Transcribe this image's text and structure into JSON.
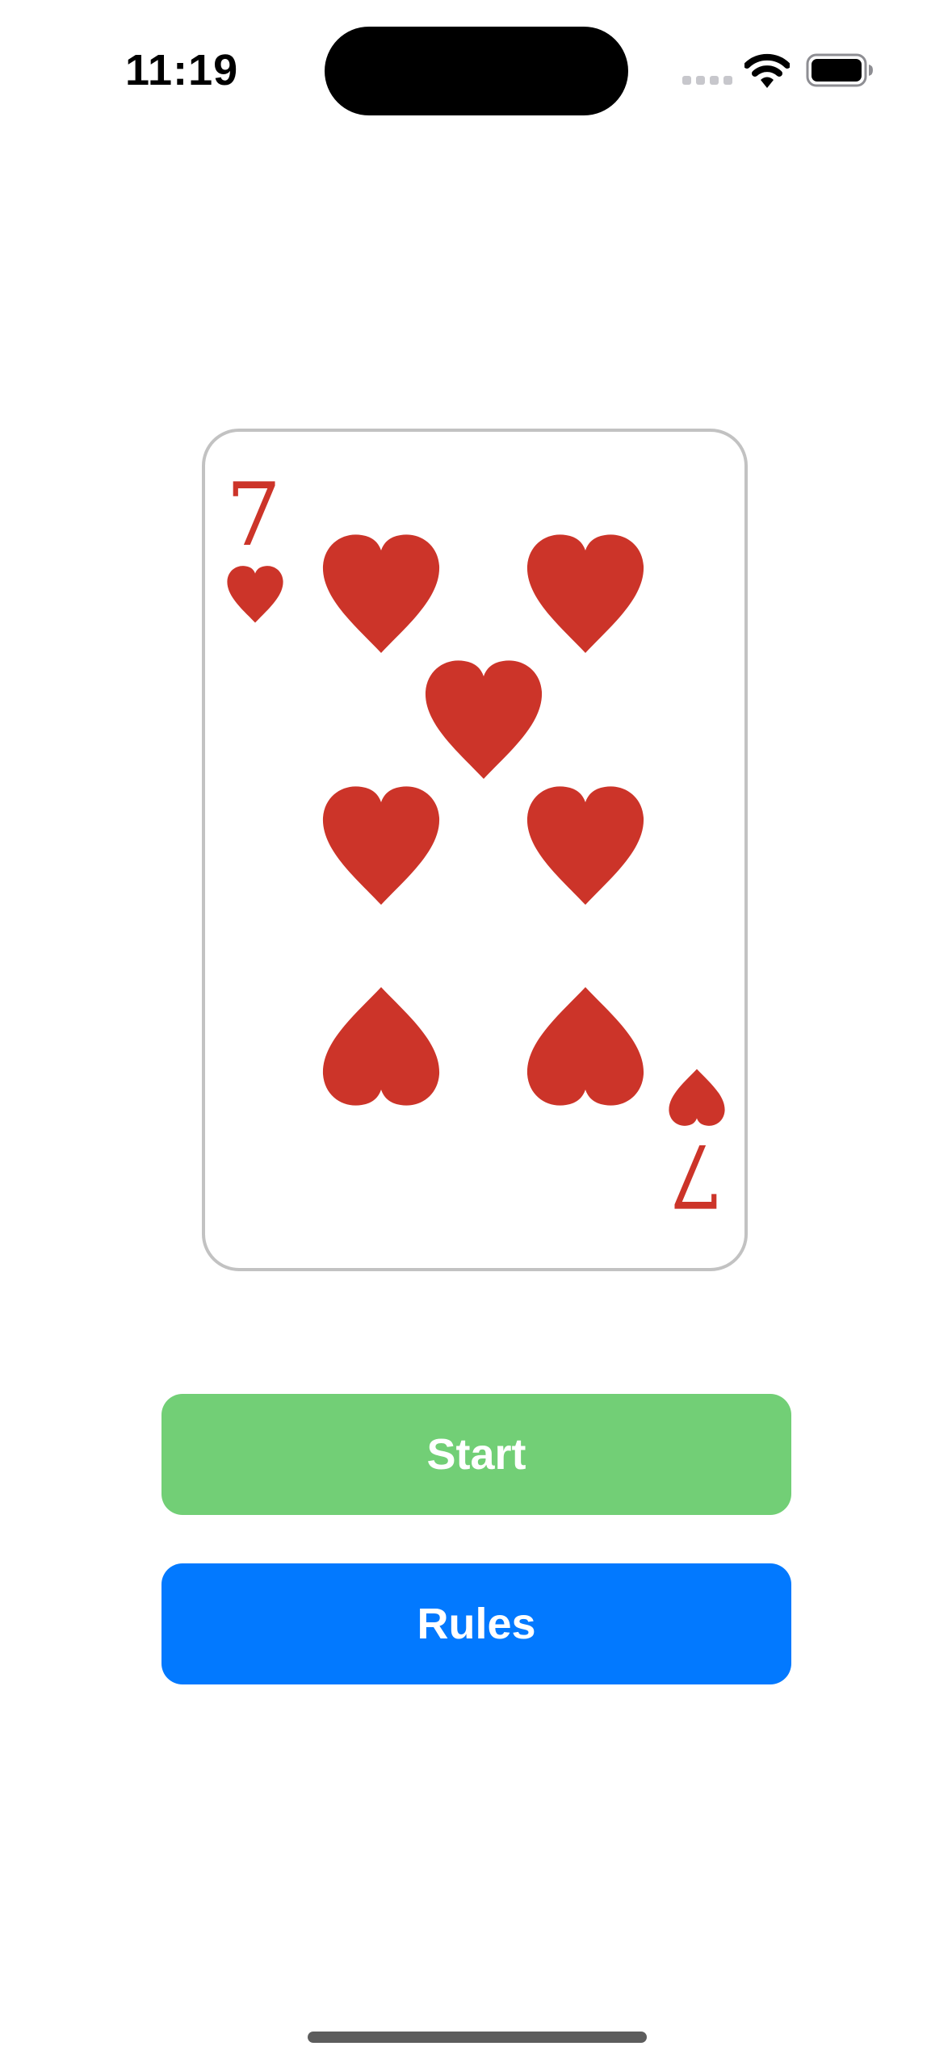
{
  "status_bar": {
    "time": "11:19",
    "icons": [
      "cellular-signal-icon",
      "wifi-icon",
      "battery-icon"
    ]
  },
  "card": {
    "rank": "7",
    "suit": "hearts",
    "suit_icon": "heart-icon",
    "pip_count": 7,
    "color": "#cc3429",
    "border_color": "#c2c2c2"
  },
  "buttons": {
    "start": {
      "label": "Start",
      "color": "#72cf76"
    },
    "rules": {
      "label": "Rules",
      "color": "#0279ff"
    }
  }
}
